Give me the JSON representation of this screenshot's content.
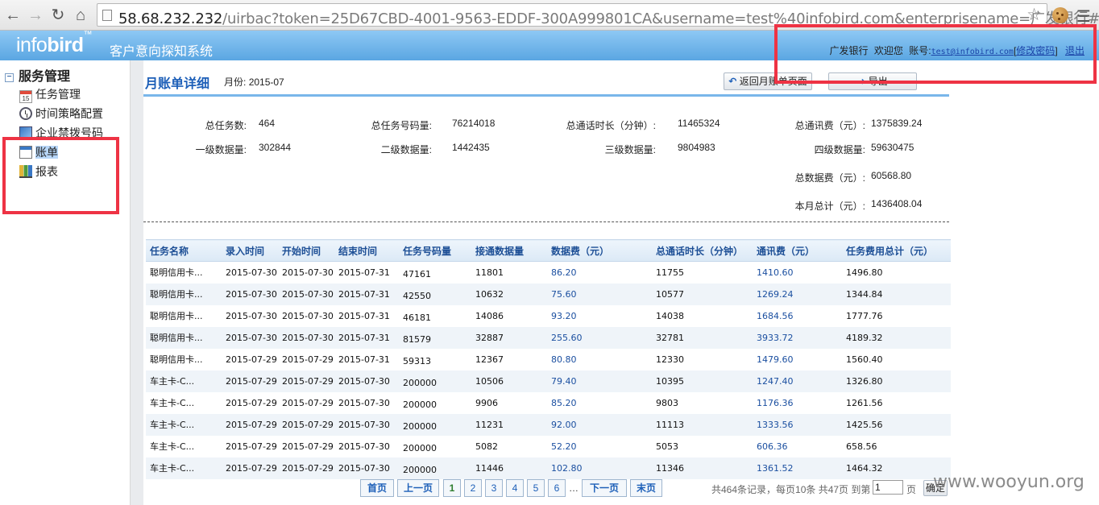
{
  "browser": {
    "url_host": "58.68.232.232",
    "url_rest": "/uirbac?token=25D67CBD-4001-9563-EDDF-300A999801CA&username=test%40infobird.com&enterprisename=广发银行#"
  },
  "header": {
    "logo_light": "info",
    "logo_bold": "bird",
    "logo_tm": "™",
    "system_title": "客户意向探知系统",
    "company": "广发银行",
    "welcome": "欢迎您",
    "account_label": "账号:",
    "account_email": "test@infobird.com",
    "change_password": "修改密码",
    "logout": "退出"
  },
  "sidebar": {
    "root": "服务管理",
    "items": [
      {
        "label": "任务管理",
        "icon": "calendar-icon"
      },
      {
        "label": "时间策略配置",
        "icon": "clock-icon"
      },
      {
        "label": "企业禁拨号码",
        "icon": "phone-book-icon"
      },
      {
        "label": "账单",
        "icon": "bill-icon",
        "selected": true
      },
      {
        "label": "报表",
        "icon": "bar-chart-icon"
      }
    ]
  },
  "page": {
    "title": "月账单详细",
    "month_label": "月份:",
    "month": "2015-07",
    "back_button": "返回月账单页面",
    "export_button": "导出"
  },
  "summary": {
    "total_tasks_label": "总任务数:",
    "total_tasks": "464",
    "total_numbers_label": "总任务号码量:",
    "total_numbers": "76214018",
    "total_minutes_label": "总通话时长（分钟）:",
    "total_minutes": "11465324",
    "total_comm_fee_label": "总通讯费（元）:",
    "total_comm_fee": "1375839.24",
    "level1_label": "一级数据量:",
    "level1": "302844",
    "level2_label": "二级数据量:",
    "level2": "1442435",
    "level3_label": "三级数据量:",
    "level3": "9804983",
    "level4_label": "四级数据量:",
    "level4": "59630475",
    "total_data_fee_label": "总数据费（元）:",
    "total_data_fee": "60568.80",
    "month_total_label": "本月总计（元）:",
    "month_total": "1436408.04"
  },
  "table": {
    "columns": [
      "任务名称",
      "录入时间",
      "开始时间",
      "结束时间",
      "任务号码量",
      "接通数据量",
      "数据费（元）",
      "总通话时长（分钟）",
      "通讯费（元）",
      "任务费用总计（元）"
    ],
    "rows": [
      [
        "聪明信用卡...",
        "2015-07-30",
        "2015-07-30",
        "2015-07-31",
        "47161",
        "11801",
        "86.20",
        "11755",
        "1410.60",
        "1496.80"
      ],
      [
        "聪明信用卡...",
        "2015-07-30",
        "2015-07-30",
        "2015-07-31",
        "42550",
        "10632",
        "75.60",
        "10577",
        "1269.24",
        "1344.84"
      ],
      [
        "聪明信用卡...",
        "2015-07-30",
        "2015-07-30",
        "2015-07-31",
        "46181",
        "14086",
        "93.20",
        "14038",
        "1684.56",
        "1777.76"
      ],
      [
        "聪明信用卡...",
        "2015-07-30",
        "2015-07-30",
        "2015-07-31",
        "81579",
        "32887",
        "255.60",
        "32781",
        "3933.72",
        "4189.32"
      ],
      [
        "聪明信用卡...",
        "2015-07-29",
        "2015-07-29",
        "2015-07-31",
        "59313",
        "12367",
        "80.80",
        "12330",
        "1479.60",
        "1560.40"
      ],
      [
        "车主卡-C...",
        "2015-07-29",
        "2015-07-29",
        "2015-07-30",
        "200000",
        "10506",
        "79.40",
        "10395",
        "1247.40",
        "1326.80"
      ],
      [
        "车主卡-C...",
        "2015-07-29",
        "2015-07-29",
        "2015-07-30",
        "200000",
        "9906",
        "85.20",
        "9803",
        "1176.36",
        "1261.56"
      ],
      [
        "车主卡-C...",
        "2015-07-29",
        "2015-07-29",
        "2015-07-30",
        "200000",
        "11231",
        "92.00",
        "11113",
        "1333.56",
        "1425.56"
      ],
      [
        "车主卡-C...",
        "2015-07-29",
        "2015-07-29",
        "2015-07-30",
        "200000",
        "5082",
        "52.20",
        "5053",
        "606.36",
        "658.56"
      ],
      [
        "车主卡-C...",
        "2015-07-29",
        "2015-07-29",
        "2015-07-30",
        "200000",
        "11446",
        "102.80",
        "11346",
        "1361.52",
        "1464.32"
      ]
    ]
  },
  "pager": {
    "first": "首页",
    "prev": "上一页",
    "pages": [
      "1",
      "2",
      "3",
      "4",
      "5",
      "6"
    ],
    "current": "1",
    "ellipsis": "…",
    "next": "下一页",
    "last": "末页",
    "summary": "共464条记录，每页10条 共47页 到第",
    "page_input": "1",
    "page_suffix": "页",
    "go": "确定"
  },
  "watermark": "www.wooyun.org"
}
